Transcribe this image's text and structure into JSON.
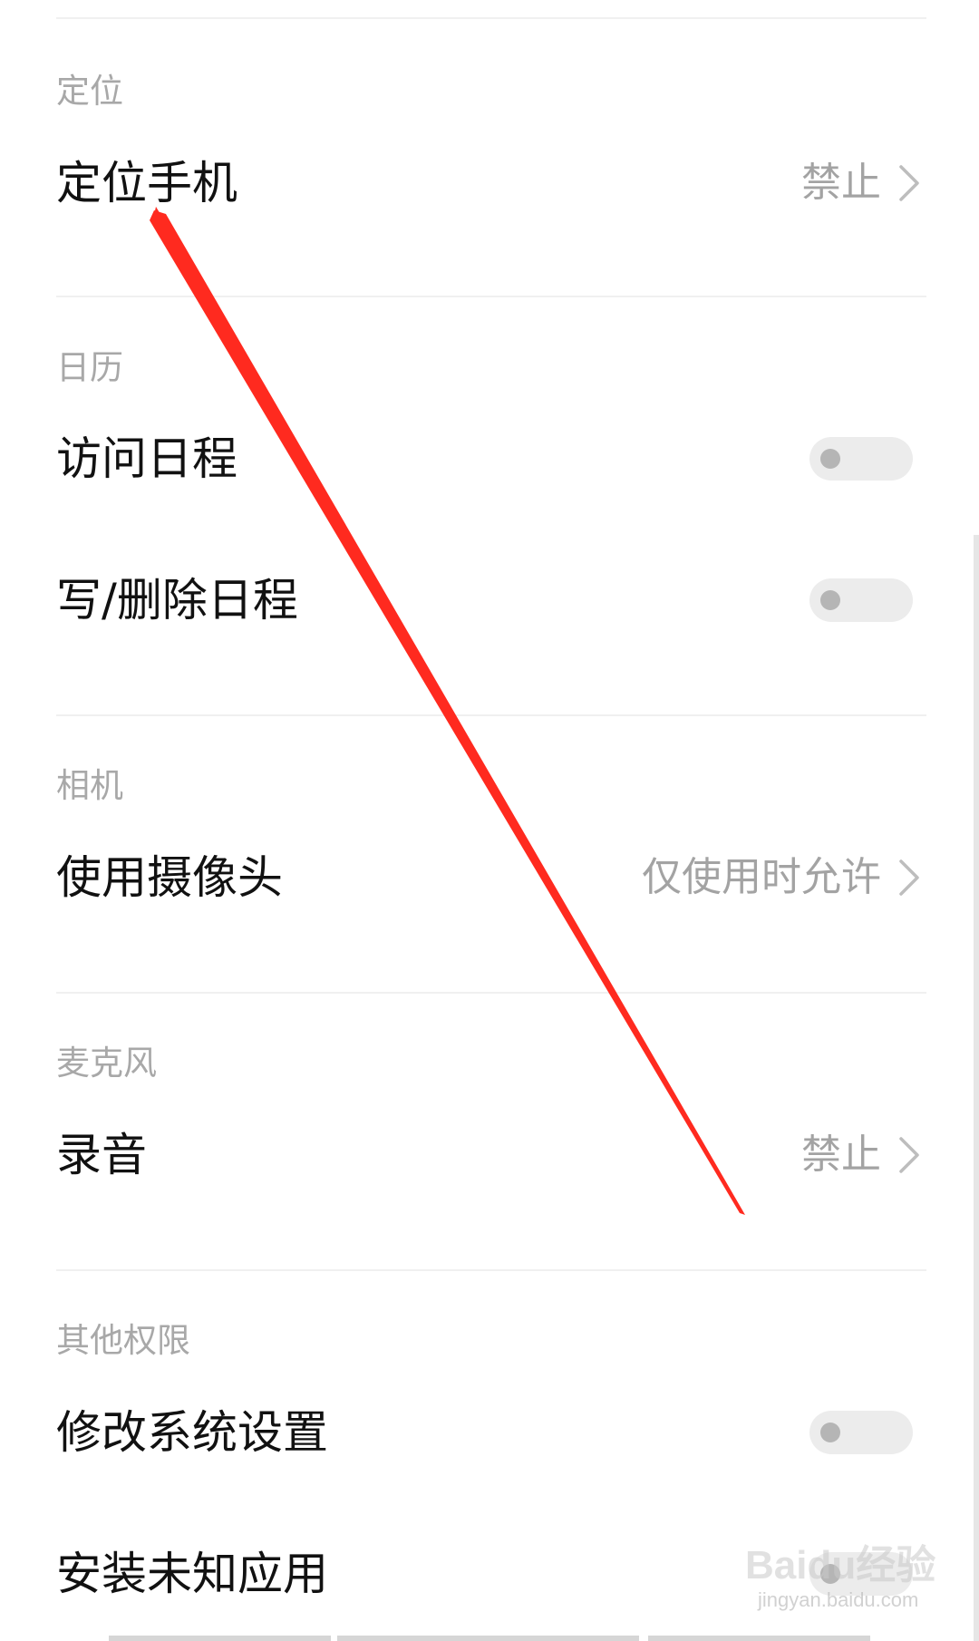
{
  "sections": [
    {
      "header": "定位",
      "rows": [
        {
          "label": "定位手机",
          "value": "禁止"
        }
      ]
    },
    {
      "header": "日历",
      "rows": [
        {
          "label": "访问日程",
          "toggle_on": false
        },
        {
          "label": "写/删除日程",
          "toggle_on": false
        }
      ]
    },
    {
      "header": "相机",
      "rows": [
        {
          "label": "使用摄像头",
          "value": "仅使用时允许"
        }
      ]
    },
    {
      "header": "麦克风",
      "rows": [
        {
          "label": "录音",
          "value": "禁止"
        }
      ]
    },
    {
      "header": "其他权限",
      "rows": [
        {
          "label": "修改系统设置",
          "toggle_on": false
        },
        {
          "label": "安装未知应用",
          "toggle_on": false
        }
      ]
    }
  ],
  "colors": {
    "annotation_arrow": "#ff2a1f",
    "toggle_off_track": "#ececec",
    "toggle_off_knob": "#b5b5b5"
  },
  "watermark": {
    "logo": "Baidu经验",
    "url": "jingyan.baidu.com"
  },
  "icons": {
    "row_chevron": "chevron-right-icon"
  }
}
